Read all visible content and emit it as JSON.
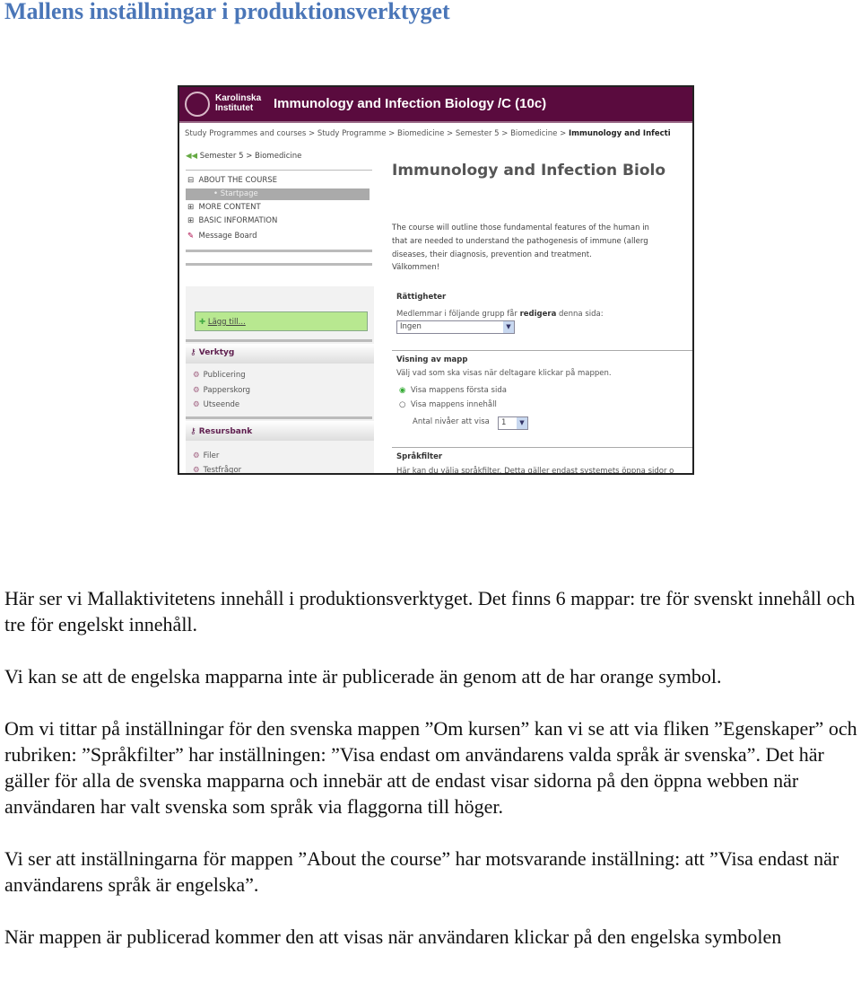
{
  "title": "Mallens inställningar i produktionsverktyget",
  "screenshot": {
    "logo_text": "Karolinska Institutet",
    "header_title": "Immunology and Infection Biology /C (10c)",
    "breadcrumb": [
      "Study Programmes and courses",
      "Study Programme",
      "Biomedicine",
      "Semester 5",
      "Biomedicine"
    ],
    "breadcrumb_current": "Immunology and Infecti",
    "back_link": "Semester 5 > Biomedicine",
    "menu": [
      {
        "label": "ABOUT THE COURSE",
        "icon": "minus-box-icon"
      },
      {
        "label": "Startpage",
        "icon": "bullet-icon"
      },
      {
        "label": "MORE CONTENT",
        "icon": "plus-box-icon"
      },
      {
        "label": "BASIC INFORMATION",
        "icon": "plus-box-icon"
      },
      {
        "label": "Message Board",
        "icon": "pin-icon"
      }
    ],
    "add_link": "Lägg till...",
    "tools_header": "Verktyg",
    "tools": [
      "Publicering",
      "Papperskorg",
      "Utseende"
    ],
    "resources_header": "Resursbank",
    "resources": [
      "Filer",
      "Testfrågor"
    ],
    "page_title": "Immunology and Infection Biolo",
    "intro": [
      "The course will outline those fundamental features of the human in",
      "that are needed to understand the pathogenesis of immune (allerg",
      "diseases, their diagnosis, prevention and treatment.",
      "Välkommen!"
    ],
    "rights_heading": "Rättigheter",
    "rights_label_pre": "Medlemmar i följande grupp får ",
    "rights_label_bold": "redigera",
    "rights_label_post": " denna sida:",
    "rights_value": "Ingen",
    "view_heading": "Visning av mapp",
    "view_label": "Välj vad som ska visas när deltagare klickar på mappen.",
    "radio_1": "Visa mappens första sida",
    "radio_2": "Visa mappens innehåll",
    "radio_selected": 1,
    "levels_label": "Antal nivåer att visa",
    "levels_value": "1",
    "lang_heading": "Språkfilter",
    "lang_text": "Här kan du välja språkfilter. Detta gäller endast systemets öppna sidor o"
  },
  "paragraphs": [
    "Här ser vi Mallaktivitetens innehåll i produktionsverktyget. Det finns 6 mappar: tre för svenskt innehåll och tre för engelskt innehåll.",
    "Vi kan se att de engelska mapparna inte är publicerade än genom att de har orange symbol.",
    "Om vi tittar på inställningar för den svenska mappen ”Om kursen” kan vi se att via fliken ”Egenskaper” och rubriken: ”Språkfilter” har inställningen: ”Visa endast om användarens valda språk är svenska”. Det här gäller för alla de svenska mapparna och innebär att de endast visar sidorna på den öppna webben när användaren har valt svenska som språk via flaggorna till höger.",
    "Vi ser att inställningarna för mappen ”About the course” har motsvarande inställning: att ”Visa endast när användarens språk är engelska”.",
    "När mappen är publicerad kommer den att visas när användaren klickar på den engelska symbolen"
  ]
}
